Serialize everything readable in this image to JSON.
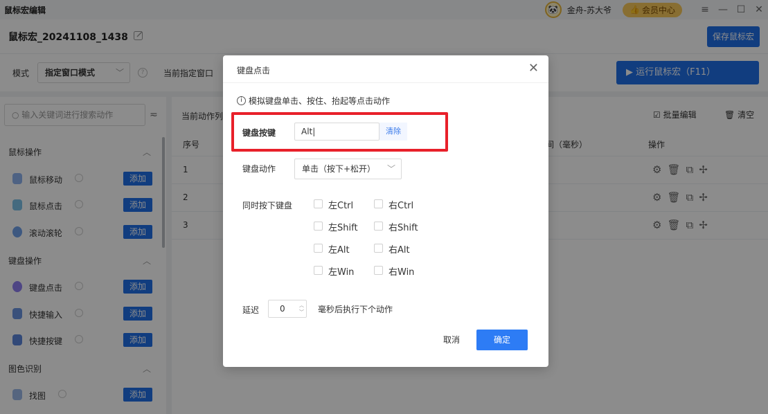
{
  "app": {
    "title": "鼠标宏编辑",
    "user": "金舟-苏大爷",
    "vip": "会员中心",
    "window_controls": [
      "≡",
      "—",
      "☐",
      "✕"
    ]
  },
  "editor": {
    "macro_name": "鼠标宏_20241108_1438",
    "save_label": "保存鼠标宏"
  },
  "toolbar": {
    "mode_label": "模式",
    "mode_value": "指定窗口模式",
    "current_window_label": "当前指定窗口",
    "run_label": "▶ 运行鼠标宏（F11）"
  },
  "sidebar": {
    "search_placeholder": "输入关键词进行搜索动作",
    "sections": [
      {
        "title": "鼠标操作",
        "items": [
          {
            "label": "鼠标移动",
            "add": "添加"
          },
          {
            "label": "鼠标点击",
            "add": "添加"
          },
          {
            "label": "滚动滚轮",
            "add": "添加"
          }
        ]
      },
      {
        "title": "键盘操作",
        "items": [
          {
            "label": "键盘点击",
            "add": "添加"
          },
          {
            "label": "快捷输入",
            "add": "添加"
          },
          {
            "label": "快捷按键",
            "add": "添加"
          }
        ]
      },
      {
        "title": "图色识别",
        "items": [
          {
            "label": "找图",
            "add": "添加"
          }
        ]
      }
    ]
  },
  "main": {
    "current_actions": "当前动作列表",
    "batch_edit": "批量编辑",
    "clear": "清空",
    "columns": {
      "index": "序号",
      "time": "间（毫秒）",
      "ops": "操作"
    },
    "rows": [
      "1",
      "2",
      "3"
    ]
  },
  "dialog": {
    "title": "键盘点击",
    "tip": "模拟键盘单击、按住、抬起等点击动作",
    "key_label": "键盘按键",
    "key_value": "Alt",
    "key_clear": "清除",
    "action_label": "键盘动作",
    "action_value": "单击（按下+松开）",
    "modifiers_label": "同时按下键盘",
    "modifiers": [
      "左Ctrl",
      "右Ctrl",
      "左Shift",
      "右Shift",
      "左Alt",
      "右Alt",
      "左Win",
      "右Win"
    ],
    "delay_label": "延迟",
    "delay_value": "0",
    "delay_suffix": "毫秒后执行下个动作",
    "cancel": "取消",
    "confirm": "确定"
  },
  "colors": {
    "accent": "#1f6fe8",
    "highlight": "#e8202a"
  }
}
